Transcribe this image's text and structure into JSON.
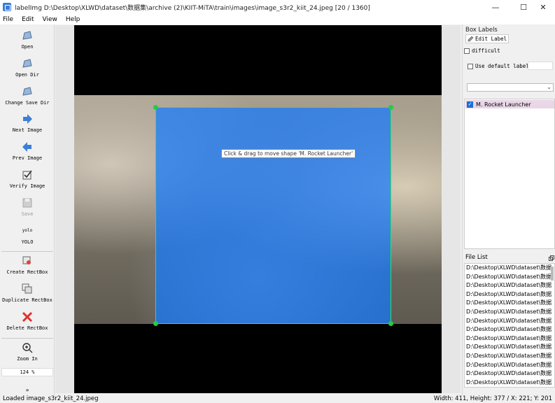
{
  "window": {
    "title": "labelImg D:\\Desktop\\XLWD\\dataset\\数据集\\archive (2)\\KIIT-MiTA\\train\\images\\image_s3r2_kiit_24.jpeg [20 / 1360]",
    "controls": {
      "minimize": "—",
      "maximize": "☐",
      "close": "✕"
    }
  },
  "menu": [
    "File",
    "Edit",
    "View",
    "Help"
  ],
  "toolbar": {
    "open": "Open",
    "open_dir": "Open Dir",
    "change_save_dir": "Change Save Dir",
    "next_image": "Next Image",
    "prev_image": "Prev Image",
    "verify_image": "Verify Image",
    "save": "Save",
    "format_icon_text": "yolo",
    "format": "YOLO",
    "create_rectbox": "Create RectBox",
    "duplicate_rectbox": "Duplicate RectBox",
    "delete_rectbox": "Delete RectBox",
    "zoom_in": "Zoom In",
    "zoom_value": "124 %",
    "more": "»"
  },
  "canvas": {
    "tooltip": "Click & drag to move shape 'M. Rocket Launcher'"
  },
  "box_labels": {
    "title": "Box Labels",
    "edit_label": "Edit Label",
    "difficult": "difficult",
    "use_default_label": "Use default label",
    "labels": [
      {
        "name": "M. Rocket Launcher",
        "checked": true
      }
    ]
  },
  "file_list": {
    "title": "File List",
    "items": [
      "D:\\Desktop\\XLWD\\dataset\\数据",
      "D:\\Desktop\\XLWD\\dataset\\数据",
      "D:\\Desktop\\XLWD\\dataset\\数据",
      "D:\\Desktop\\XLWD\\dataset\\数据",
      "D:\\Desktop\\XLWD\\dataset\\数据",
      "D:\\Desktop\\XLWD\\dataset\\数据",
      "D:\\Desktop\\XLWD\\dataset\\数据",
      "D:\\Desktop\\XLWD\\dataset\\数据",
      "D:\\Desktop\\XLWD\\dataset\\数据",
      "D:\\Desktop\\XLWD\\dataset\\数据",
      "D:\\Desktop\\XLWD\\dataset\\数据",
      "D:\\Desktop\\XLWD\\dataset\\数据",
      "D:\\Desktop\\XLWD\\dataset\\数据",
      "D:\\Desktop\\XLWD\\dataset\\数据"
    ]
  },
  "status": {
    "left": "Loaded image_s3r2_kiit_24.jpeg",
    "right": "Width: 411, Height: 377 / X: 221; Y: 201"
  },
  "colors": {
    "bbox_fill": "#1478ff",
    "bbox_edge": "#2ce84a",
    "selected_label_bg": "#e9d6e6"
  }
}
